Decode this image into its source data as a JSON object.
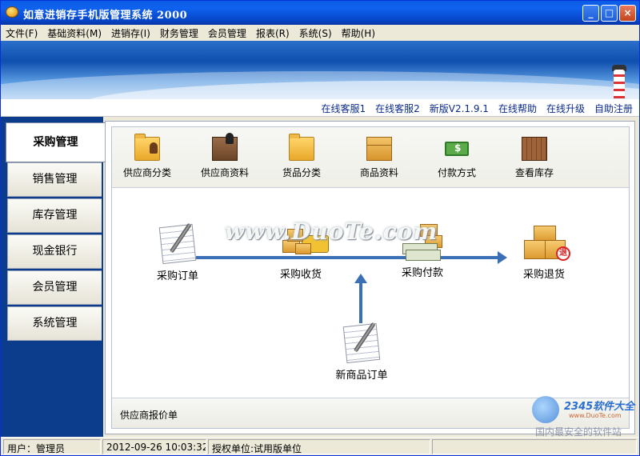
{
  "window": {
    "title": "如意进销存手机版管理系统 2000",
    "min_label": "_",
    "max_label": "□",
    "close_label": "×"
  },
  "menu": [
    "文件(F)",
    "基础资料(M)",
    "进销存(I)",
    "财务管理",
    "会员管理",
    "报表(R)",
    "系统(S)",
    "帮助(H)"
  ],
  "links": [
    "在线客服1",
    "在线客服2",
    "新版V2.1.9.1",
    "在线帮助",
    "在线升级",
    "自助注册"
  ],
  "nav_tabs": [
    "采购管理",
    "销售管理",
    "库存管理",
    "现金银行",
    "会员管理",
    "系统管理"
  ],
  "active_tab": "采购管理",
  "toolbar": [
    {
      "label": "供应商分类",
      "icon": "folder-person-icon"
    },
    {
      "label": "供应商资料",
      "icon": "supplier-person-icon"
    },
    {
      "label": "货品分类",
      "icon": "folder-icon"
    },
    {
      "label": "商品资料",
      "icon": "box-icon"
    },
    {
      "label": "付款方式",
      "icon": "money-icon"
    },
    {
      "label": "查看库存",
      "icon": "crate-icon"
    }
  ],
  "flow": {
    "order": "采购订单",
    "receive": "采购收货",
    "pay": "采购付款",
    "return": "采购退货",
    "return_badge": "退",
    "new_item_order": "新商品订单"
  },
  "bottom_link": "供应商报价单",
  "status": {
    "user": "用户：管理员",
    "datetime": "2012-09-26 10:03:32",
    "license": "授权单位:试用版单位"
  },
  "watermarks": {
    "duote": "www.DuoTe.com",
    "site_name": "2345软件大全",
    "site_url": "www.DuoTe.com",
    "site_slogan": "国内最安全的软件站"
  },
  "colors": {
    "title_bar": "#0a5ce5",
    "nav_panel": "#0c3d8c",
    "link_text": "#0b2b8a",
    "arrow": "#3b6fb6"
  }
}
